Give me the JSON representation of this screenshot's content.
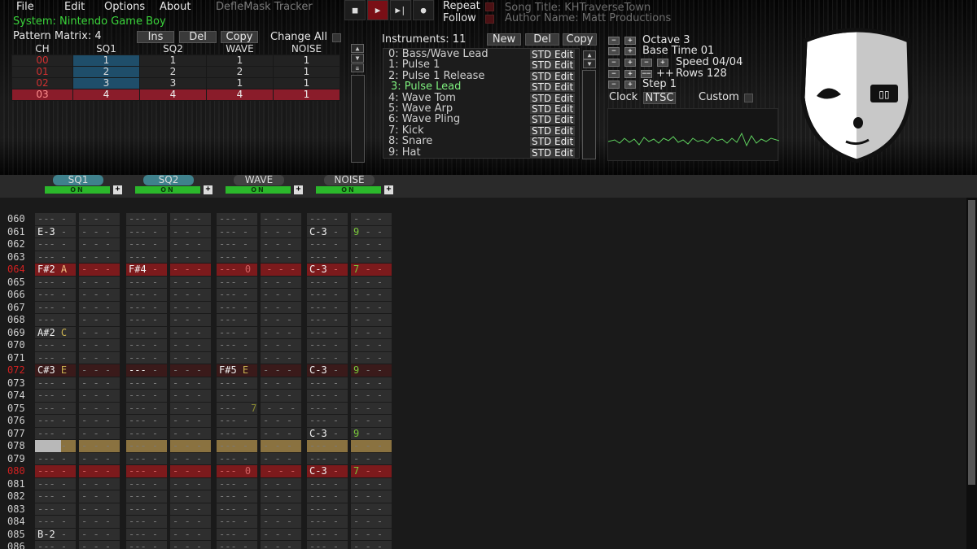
{
  "menu": {
    "file": "File",
    "edit": "Edit",
    "options": "Options",
    "about": "About"
  },
  "window_title": "DefleMask Tracker",
  "transport": {
    "stop": "■",
    "play": "▶",
    "next": "▶|",
    "record": "●"
  },
  "repeat_label": "Repeat",
  "follow_label": "Follow",
  "song_title": "Song Title: KHTraverseTown",
  "author": "Author Name: Matt Productions",
  "system": "System: Nintendo Game Boy",
  "pattern_matrix": {
    "label": "Pattern Matrix: 4",
    "ins": "Ins",
    "del": "Del",
    "copy": "Copy",
    "change_all": "Change All",
    "headers": [
      "CH",
      "SQ1",
      "SQ2",
      "WAVE",
      "NOISE"
    ],
    "rows": [
      [
        "00",
        "1",
        "1",
        "1",
        "1"
      ],
      [
        "01",
        "2",
        "2",
        "2",
        "1"
      ],
      [
        "02",
        "3",
        "3",
        "1",
        "1"
      ],
      [
        "03",
        "4",
        "4",
        "4",
        "1"
      ]
    ]
  },
  "instruments": {
    "label": "Instruments: 11",
    "new": "New",
    "del": "Del",
    "copy": "Copy",
    "items": [
      "0: Bass/Wave Lead",
      "1: Pulse 1",
      "2: Pulse 1 Release",
      "3: Pulse Lead",
      "4: Wave Tom",
      "5: Wave Arp",
      "6: Wave Pling",
      "7: Kick",
      "8: Snare",
      "9: Hat"
    ],
    "edit_label": "STD Edit",
    "selected": 3
  },
  "settings": {
    "octave": "Octave 3",
    "base_time": "Base Time 01",
    "speed": "Speed 04/04",
    "rows": "Rows 128",
    "step": "Step 1",
    "clock_label": "Clock",
    "clock_value": "NTSC",
    "custom": "Custom"
  },
  "channels": [
    {
      "name": "SQ1",
      "on": "ON"
    },
    {
      "name": "SQ2",
      "on": "ON"
    },
    {
      "name": "WAVE",
      "on": "ON"
    },
    {
      "name": "NOISE",
      "on": "ON"
    }
  ],
  "colors": {
    "accent_red": "#7c1a1c",
    "active_green": "#3ad43a",
    "highlight_yellow": "#8a7240"
  },
  "pattern_rows": [
    {
      "n": "060"
    },
    {
      "n": "061",
      "sq1": "E-3",
      "nz": "C-3",
      "nzv": "9"
    },
    {
      "n": "062"
    },
    {
      "n": "063"
    },
    {
      "n": "064",
      "hl": true,
      "sq1": "F#2",
      "sq1i": "A",
      "sq2": "F#4",
      "wave": "---",
      "wavev": "0",
      "nz": "C-3",
      "nzv": "7"
    },
    {
      "n": "065"
    },
    {
      "n": "066"
    },
    {
      "n": "067"
    },
    {
      "n": "068"
    },
    {
      "n": "069",
      "sq1": "A#2",
      "sq1i": "C"
    },
    {
      "n": "070"
    },
    {
      "n": "071"
    },
    {
      "n": "072",
      "hl2": true,
      "sq1": "C#3",
      "sq1i": "E",
      "sq2": "---",
      "wave": "F#5",
      "wavei": "E",
      "nz": "C-3",
      "nzv": "9"
    },
    {
      "n": "073"
    },
    {
      "n": "074"
    },
    {
      "n": "075",
      "wavev": "7"
    },
    {
      "n": "076"
    },
    {
      "n": "077",
      "nz": "C-3",
      "nzv": "9"
    },
    {
      "n": "078",
      "cursor": true
    },
    {
      "n": "079"
    },
    {
      "n": "080",
      "hl": true,
      "sq1": "---",
      "sq2": "---",
      "wave": "---",
      "wavev": "0",
      "nz": "C-3",
      "nzv": "7"
    },
    {
      "n": "081"
    },
    {
      "n": "082"
    },
    {
      "n": "083"
    },
    {
      "n": "084"
    },
    {
      "n": "085",
      "sq1": "B-2"
    },
    {
      "n": "086"
    }
  ]
}
